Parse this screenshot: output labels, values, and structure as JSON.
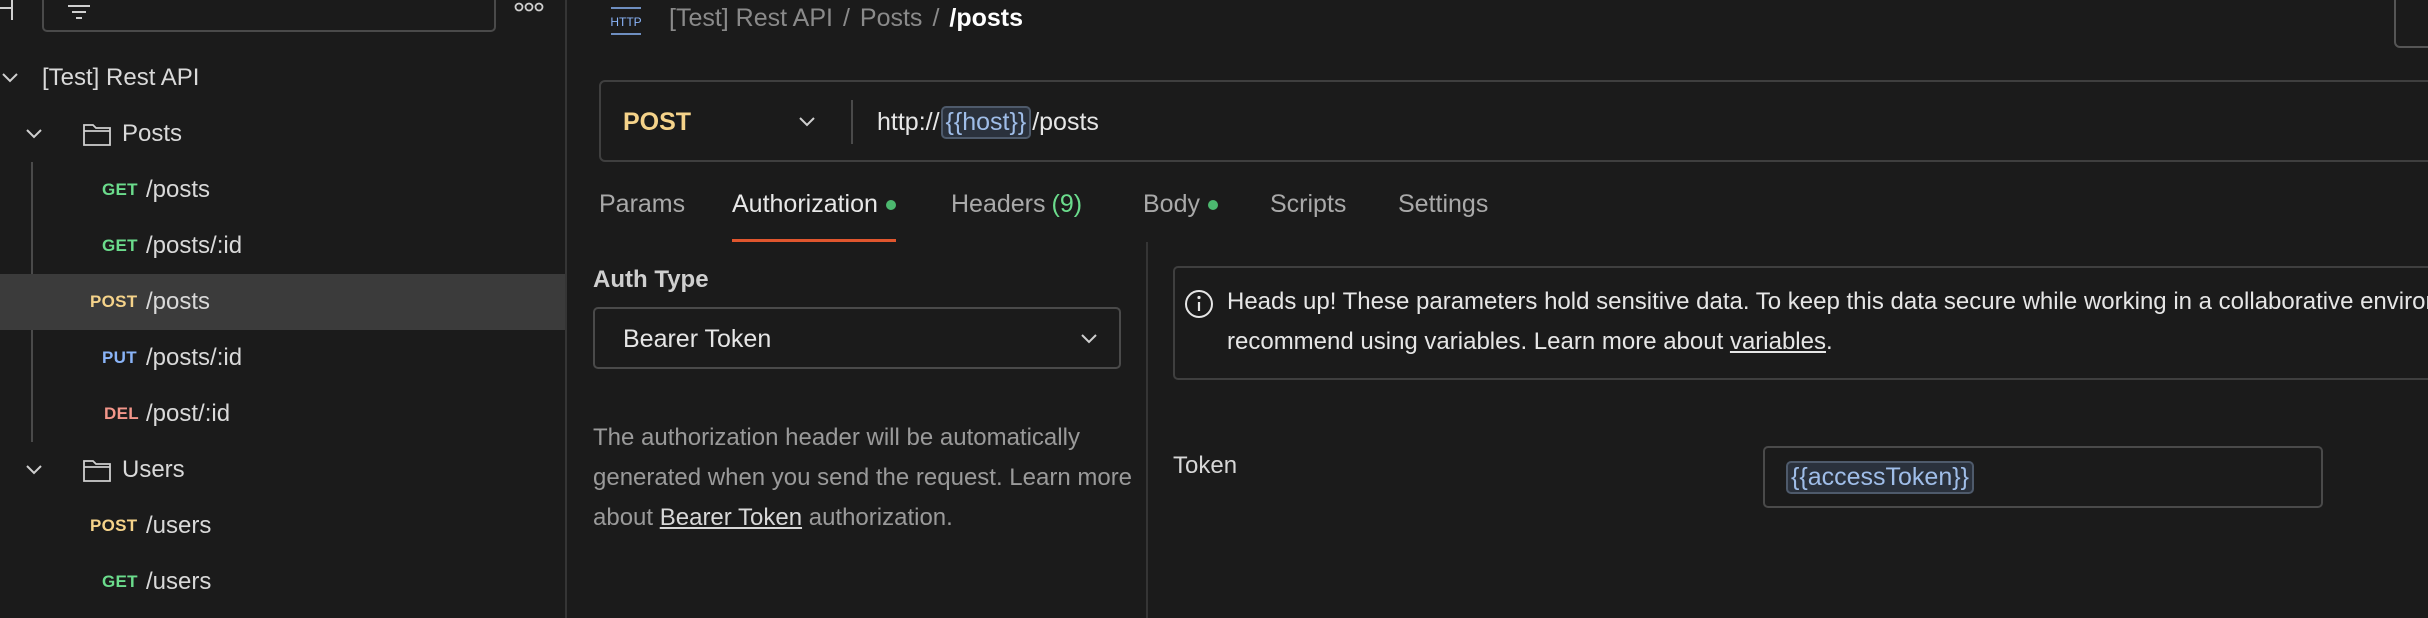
{
  "sidebar": {
    "collection": "[Test] Rest API",
    "folders": [
      {
        "name": "Posts",
        "requests": [
          {
            "method": "GET",
            "path": "/posts"
          },
          {
            "method": "GET",
            "path": "/posts/:id"
          },
          {
            "method": "POST",
            "path": "/posts"
          },
          {
            "method": "PUT",
            "path": "/posts/:id"
          },
          {
            "method": "DEL",
            "path": "/post/:id"
          }
        ]
      },
      {
        "name": "Users",
        "requests": [
          {
            "method": "POST",
            "path": "/users"
          },
          {
            "method": "GET",
            "path": "/users"
          }
        ]
      }
    ]
  },
  "header": {
    "icon_label": "HTTP",
    "breadcrumb": [
      "[Test] Rest API",
      "Posts",
      "/posts"
    ],
    "separator": "/"
  },
  "url_bar": {
    "method": "POST",
    "url_prefix": "http://",
    "url_var": "{{host}}",
    "url_suffix": "/posts"
  },
  "tabs": [
    {
      "label": "Params"
    },
    {
      "label": "Authorization",
      "active": true,
      "dot": true
    },
    {
      "label": "Headers",
      "count": "(9)"
    },
    {
      "label": "Body",
      "dot": true
    },
    {
      "label": "Scripts"
    },
    {
      "label": "Settings"
    }
  ],
  "auth": {
    "label": "Auth Type",
    "type": "Bearer Token",
    "desc_part1": "The authorization header will be automatically generated when you send the request. Learn more about ",
    "desc_link": "Bearer Token",
    "desc_part2": " authorization."
  },
  "notice": {
    "line1": "Heads up! These parameters hold sensitive data. To keep this data secure while working in a collaborative environment, we",
    "line2_part1": "recommend using variables. Learn more about ",
    "line2_link": "variables",
    "line2_part2": "."
  },
  "token": {
    "label": "Token",
    "value": "{{accessToken}}"
  },
  "colors": {
    "get": "#6bdc8c",
    "post": "#f5d38a",
    "put": "#8ab4f8",
    "del": "#f3968a",
    "accent": "#e0562e"
  }
}
